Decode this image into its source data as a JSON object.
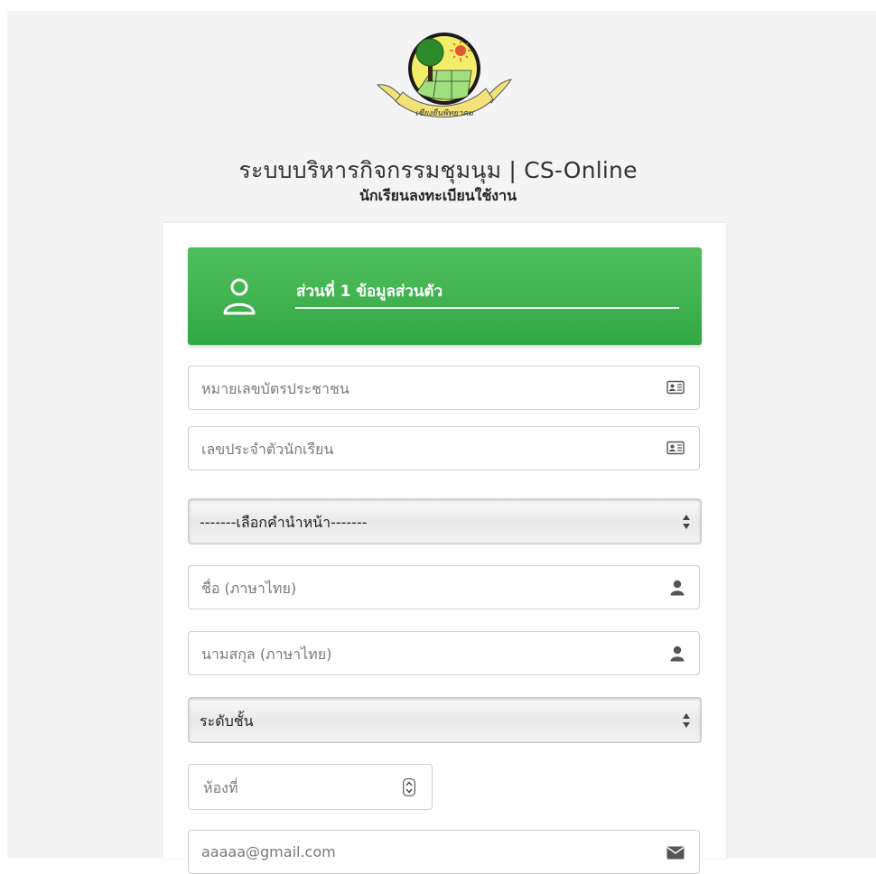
{
  "header": {
    "title": "ระบบบริหารกิจกรรมชุมนุม | CS-Online",
    "subtitle": "นักเรียนลงทะเบียนใช้งาน",
    "logo_text": "เชียงยืนพิทยาคม"
  },
  "section": {
    "title": "ส่วนที่ 1 ข้อมูลส่วนตัว",
    "icon": "user-outline-icon"
  },
  "form": {
    "national_id_placeholder": "หมายเลขบัตรประชาชน",
    "student_id_placeholder": "เลขประจำตัวนักเรียน",
    "prefix_selected": "-------เลือกคำนำหน้า-------",
    "firstname_placeholder": "ชื่อ (ภาษาไทย)",
    "lastname_placeholder": "นามสกุล (ภาษาไทย)",
    "grade_selected": "ระดับชั้น",
    "room_placeholder": "ห้องที่",
    "email_placeholder": "aaaaa@gmail.com"
  },
  "icons": {
    "id_card": "id-card-icon",
    "user": "user-icon",
    "envelope": "envelope-icon",
    "select_arrows": "select-arrows-icon",
    "spinner": "spinner-icon"
  },
  "colors": {
    "accent_green": "#3db24f",
    "page_background": "#f4f4f4"
  }
}
